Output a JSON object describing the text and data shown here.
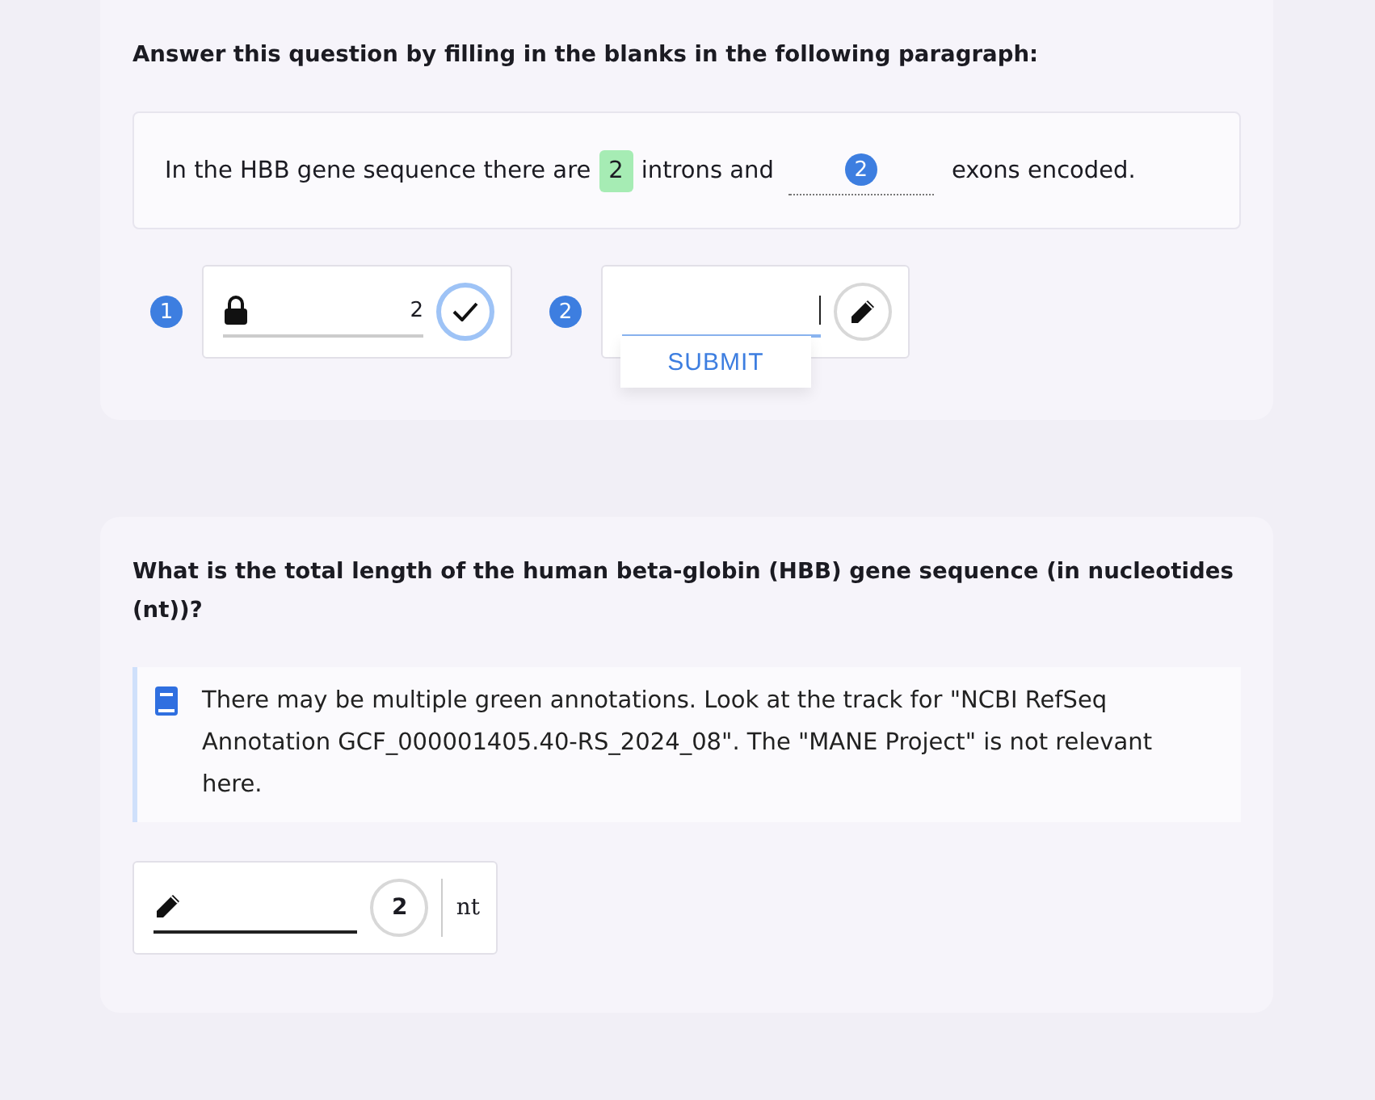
{
  "question_1": {
    "prompt": "Answer this question by filling in the blanks in the following paragraph:",
    "paragraph": [
      {
        "kind": "text",
        "text": "In the HBB gene sequence there are"
      },
      {
        "kind": "blank",
        "value": "2",
        "correct": true
      },
      {
        "kind": "text",
        "text": "introns and"
      },
      {
        "kind": "blank",
        "number": "2",
        "correct": false
      },
      {
        "kind": "text",
        "text": "exons encoded."
      }
    ],
    "answers": [
      {
        "number": "1",
        "value": "2",
        "focused": false,
        "locked": true,
        "correct": true
      },
      {
        "number": "2",
        "focused": true,
        "locked": false,
        "correct": false,
        "submit": "SUBMIT"
      }
    ]
  },
  "question_2": {
    "prompt": "What is the total length of the human beta-globin (HBB) gene sequence (in nucleotides (nt))?",
    "hint": "There may be multiple green annotations. Look at the track for \"NCBI RefSeq Annotation GCF_000001405.40-RS_2024_08\". The \"MANE Project\" is not relevant here.",
    "answer": {
      "attempts": "2",
      "unit": "nt"
    }
  }
}
